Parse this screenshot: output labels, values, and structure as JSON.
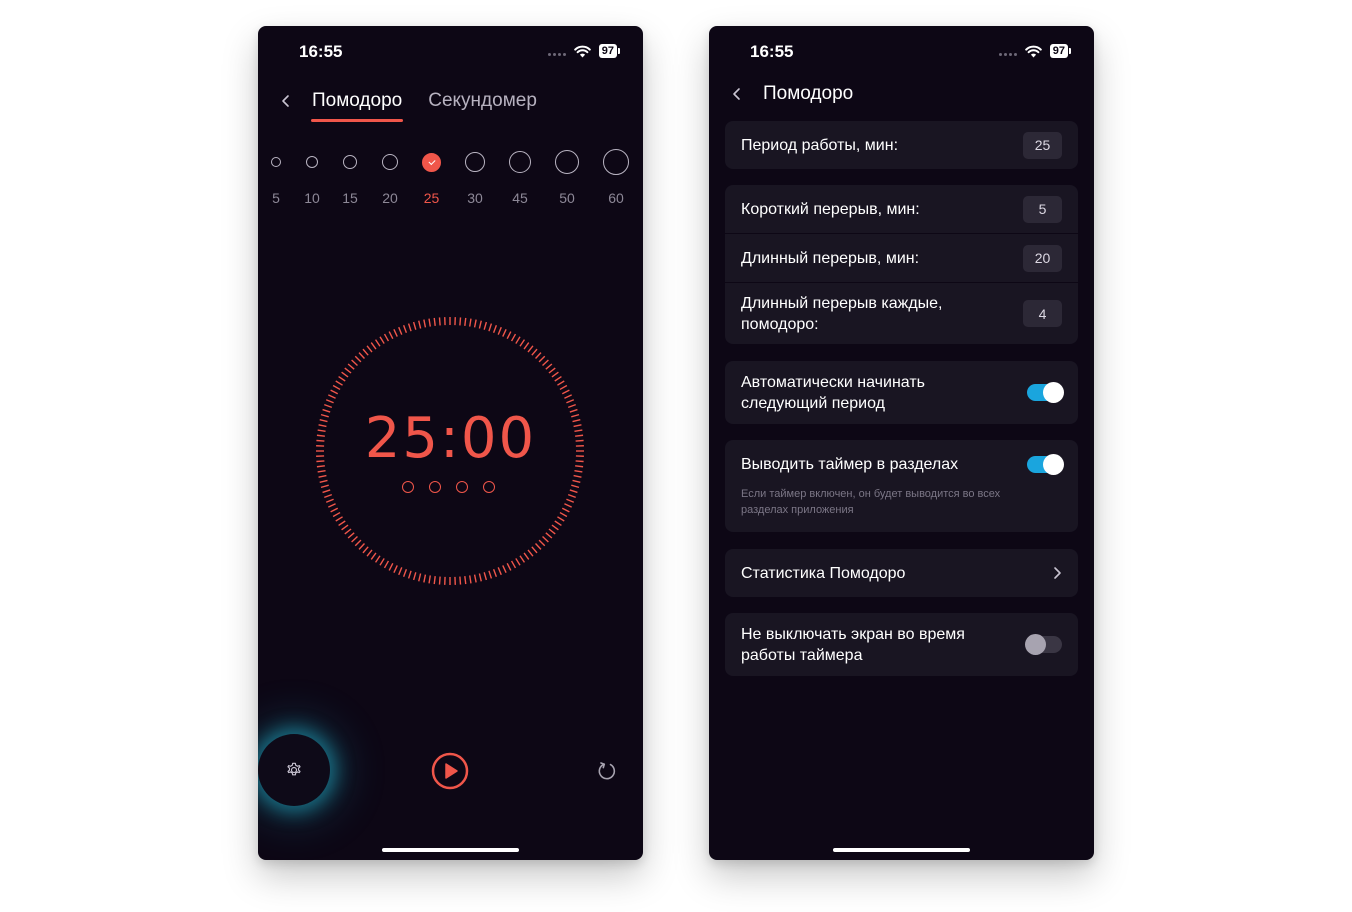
{
  "colors": {
    "accent": "#f0564a",
    "toggle_on": "#1aa5de",
    "screen_bg": "#0d0715",
    "card_bg": "#191522",
    "fab_glow": "#20afc8"
  },
  "status_bar": {
    "time": "16:55",
    "battery": "97"
  },
  "pomodoro_screen": {
    "tabs": [
      {
        "label": "Помодоро",
        "active": true
      },
      {
        "label": "Секундомер",
        "active": false
      }
    ],
    "durations": [
      {
        "label": "5",
        "selected": false
      },
      {
        "label": "10",
        "selected": false
      },
      {
        "label": "15",
        "selected": false
      },
      {
        "label": "20",
        "selected": false
      },
      {
        "label": "25",
        "selected": true
      },
      {
        "label": "30",
        "selected": false
      },
      {
        "label": "45",
        "selected": false
      },
      {
        "label": "50",
        "selected": false
      },
      {
        "label": "60",
        "selected": false
      }
    ],
    "timer": "25:00",
    "cycles": 4,
    "icons": {
      "settings": "gear-icon",
      "play": "play-icon",
      "reset": "reset-icon",
      "back": "chevron-left-icon"
    }
  },
  "settings_screen": {
    "title": "Помодоро",
    "work_period": {
      "label": "Период работы, мин:",
      "value": "25"
    },
    "short_break": {
      "label": "Короткий перерыв, мин:",
      "value": "5"
    },
    "long_break": {
      "label": "Длинный перерыв, мин:",
      "value": "20"
    },
    "long_break_every": {
      "label": "Длинный перерыв каждые, помодоро:",
      "value": "4"
    },
    "auto_start": {
      "label": "Автоматически начинать следующий период",
      "enabled": true
    },
    "show_timer": {
      "label": "Выводить таймер в разделах",
      "hint": "Если таймер включен, он будет выводится во всех разделах приложения",
      "enabled": true
    },
    "statistics": {
      "label": "Статистика Помодоро"
    },
    "keep_screen_on": {
      "label": "Не выключать экран во время работы таймера",
      "enabled": false
    }
  }
}
